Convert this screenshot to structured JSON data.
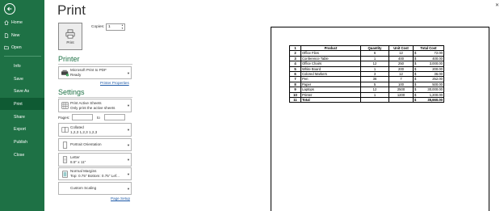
{
  "nav": {
    "items": [
      {
        "label": "Home",
        "icon": "home-icon"
      },
      {
        "label": "New",
        "icon": "new-document-icon"
      },
      {
        "label": "Open",
        "icon": "open-folder-icon"
      },
      {
        "label": "Info"
      },
      {
        "label": "Save"
      },
      {
        "label": "Save As"
      },
      {
        "label": "Print",
        "active": true
      },
      {
        "label": "Share"
      },
      {
        "label": "Export"
      },
      {
        "label": "Publish"
      },
      {
        "label": "Close"
      }
    ]
  },
  "page_title": "Print",
  "print_button": {
    "label": "Print"
  },
  "copies": {
    "label": "Copies:",
    "value": "1"
  },
  "printer": {
    "heading": "Printer",
    "name": "Microsoft Print to PDF",
    "status": "Ready",
    "properties_link": "Printer Properties"
  },
  "settings": {
    "heading": "Settings",
    "scope": {
      "line1": "Print Active Sheets",
      "line2": "Only print the active sheets"
    },
    "pages": {
      "label": "Pages:",
      "to": "to"
    },
    "collation": {
      "line1": "Collated",
      "line2": "1,2,3    1,2,3    1,2,3"
    },
    "orientation": {
      "line1": "Portrait Orientation"
    },
    "paper": {
      "line1": "Letter",
      "line2": "8.5\" x 11\""
    },
    "margins": {
      "line1": "Normal Margins",
      "line2": "Top: 0.75\" Bottom: 0.75\" Lef..."
    },
    "scaling": {
      "line1": "Custom Scaling"
    },
    "page_setup_link": "Page Setup"
  },
  "sheet": {
    "headers": [
      "1",
      "Product",
      "Quantity",
      "Unit Cost",
      "Total Cost"
    ],
    "rows": [
      {
        "n": "2",
        "product": "Office Files",
        "qty": "6",
        "unit": "12",
        "total": "72.00"
      },
      {
        "n": "3",
        "product": "Conference Table",
        "qty": "1",
        "unit": "400",
        "total": "400.00"
      },
      {
        "n": "4",
        "product": "Office Chairs",
        "qty": "12",
        "unit": "250",
        "total": "3,000.00"
      },
      {
        "n": "5",
        "product": "White Board",
        "qty": "1",
        "unit": "200",
        "total": "200.00"
      },
      {
        "n": "6",
        "product": "Colored Markers",
        "qty": "3",
        "unit": "12",
        "total": "36.00"
      },
      {
        "n": "7",
        "product": "Pen",
        "qty": "36",
        "unit": "7",
        "total": "252.00"
      },
      {
        "n": "8",
        "product": "Paper",
        "qty": "5",
        "unit": "100",
        "total": "500.00"
      },
      {
        "n": "9",
        "product": "Laptops",
        "qty": "12",
        "unit": "2500",
        "total": "30,000.00"
      },
      {
        "n": "10",
        "product": "Printer",
        "qty": "1",
        "unit": "1200",
        "total": "1,200.00"
      }
    ],
    "total_row": {
      "n": "11",
      "label": "Total",
      "total": "35,660.00"
    },
    "currency": "$"
  },
  "colors": {
    "sidebar": "#1e7145",
    "accent": "#1e7145",
    "link": "#1e5aa8"
  }
}
